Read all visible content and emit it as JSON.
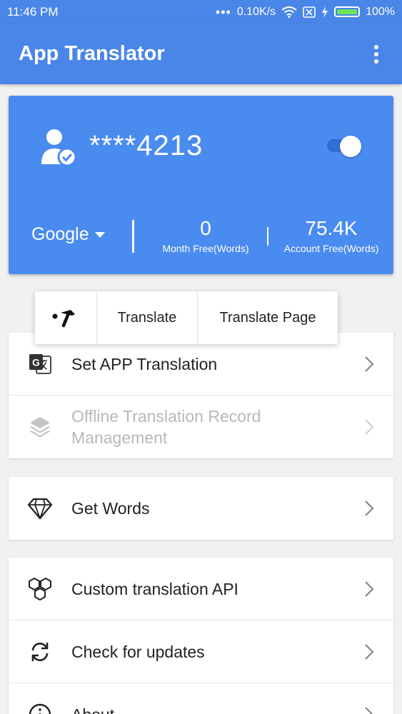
{
  "status_bar": {
    "time": "11:46 PM",
    "network_speed": "0.10K/s",
    "battery": "100%"
  },
  "app_bar": {
    "title": "App Translator"
  },
  "account": {
    "id": "****4213",
    "engine": "Google",
    "month_free": {
      "value": "0",
      "label": "Month Free(Words)"
    },
    "account_free": {
      "value": "75.4K",
      "label": "Account Free(Words)"
    }
  },
  "popup": {
    "translate": "Translate",
    "translate_page": "Translate Page"
  },
  "menu": {
    "set_app_translation": "Set APP Translation",
    "offline_record": "Offline Translation Record Management",
    "get_words": "Get Words",
    "custom_api": "Custom translation API",
    "check_updates": "Check for updates",
    "about": "About"
  },
  "colors": {
    "primary": "#4a86e8",
    "card": "#4a8bef",
    "background": "#f1f1f1"
  }
}
